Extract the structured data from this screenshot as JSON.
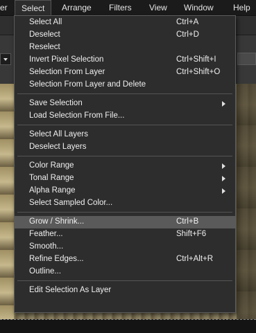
{
  "menubar": {
    "items": [
      "er",
      "Select",
      "Arrange",
      "Filters",
      "View",
      "Window",
      "Help"
    ],
    "active": "Select"
  },
  "select_menu": {
    "groups": [
      [
        {
          "label": "Select All",
          "shortcut": "Ctrl+A"
        },
        {
          "label": "Deselect",
          "shortcut": "Ctrl+D"
        },
        {
          "label": "Reselect",
          "shortcut": ""
        },
        {
          "label": "Invert Pixel Selection",
          "shortcut": "Ctrl+Shift+I"
        },
        {
          "label": "Selection From Layer",
          "shortcut": "Ctrl+Shift+O"
        },
        {
          "label": "Selection From Layer and Delete",
          "shortcut": ""
        }
      ],
      [
        {
          "label": "Save Selection",
          "shortcut": "",
          "submenu": true
        },
        {
          "label": "Load Selection From File...",
          "shortcut": ""
        }
      ],
      [
        {
          "label": "Select All Layers",
          "shortcut": ""
        },
        {
          "label": "Deselect Layers",
          "shortcut": ""
        }
      ],
      [
        {
          "label": "Color Range",
          "shortcut": "",
          "submenu": true
        },
        {
          "label": "Tonal Range",
          "shortcut": "",
          "submenu": true
        },
        {
          "label": "Alpha Range",
          "shortcut": "",
          "submenu": true
        },
        {
          "label": "Select Sampled Color...",
          "shortcut": ""
        }
      ],
      [
        {
          "label": "Grow / Shrink...",
          "shortcut": "Ctrl+B",
          "highlighted": true
        },
        {
          "label": "Feather...",
          "shortcut": "Shift+F6"
        },
        {
          "label": "Smooth...",
          "shortcut": ""
        },
        {
          "label": "Refine Edges...",
          "shortcut": "Ctrl+Alt+R"
        },
        {
          "label": "Outline...",
          "shortcut": ""
        }
      ],
      [
        {
          "label": "Edit Selection As Layer",
          "shortcut": ""
        }
      ]
    ]
  },
  "colors": {
    "menu_bg": "#2d2d2d",
    "highlight": "#5a5a5a",
    "menubar_bg": "#1b1b1b",
    "text": "#f0f0f0"
  }
}
